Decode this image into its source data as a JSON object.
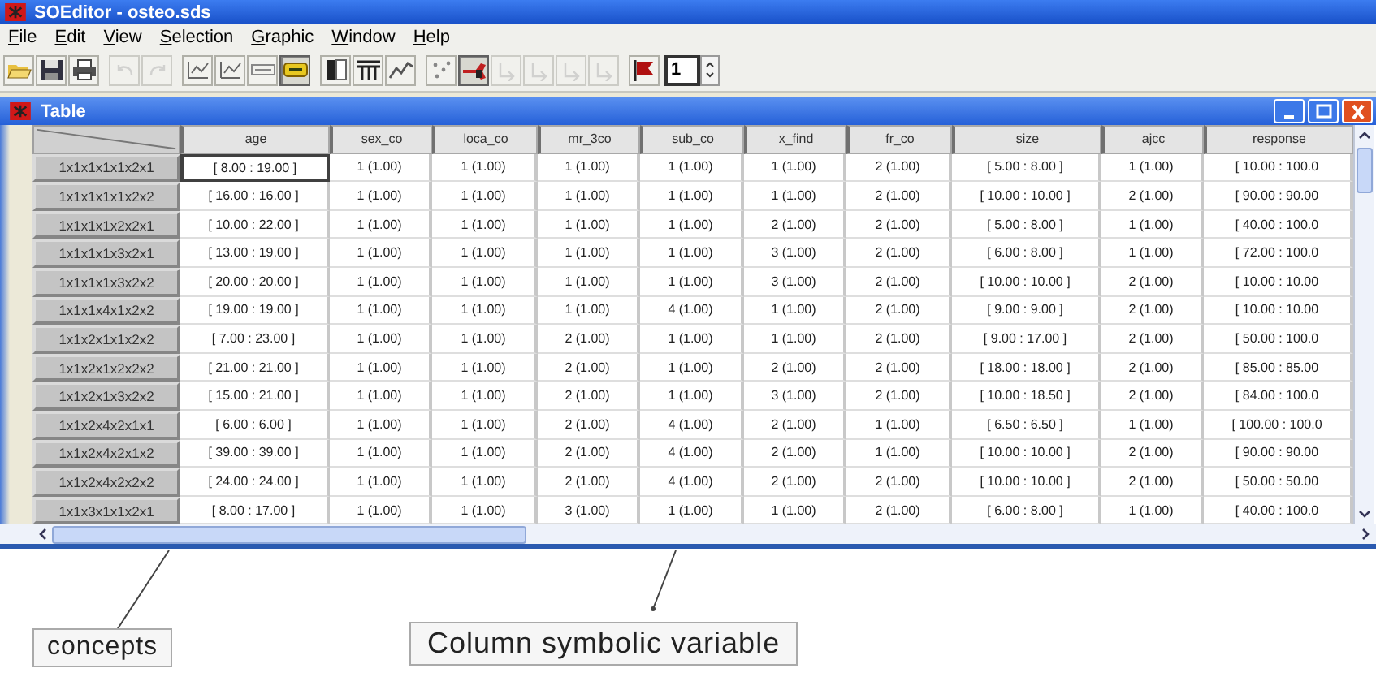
{
  "window": {
    "title": "SOEditor - osteo.sds"
  },
  "menu": [
    "File",
    "Edit",
    "View",
    "Selection",
    "Graphic",
    "Window",
    "Help"
  ],
  "toolbar": [
    [
      {
        "kind": "open",
        "pressed": false,
        "disabled": false
      },
      {
        "kind": "save",
        "pressed": false,
        "disabled": false
      },
      {
        "kind": "print",
        "pressed": false,
        "disabled": false
      }
    ],
    [
      {
        "kind": "undo",
        "pressed": false,
        "disabled": true
      },
      {
        "kind": "redo",
        "pressed": false,
        "disabled": true
      }
    ],
    [
      {
        "kind": "graph",
        "pressed": false,
        "disabled": false
      },
      {
        "kind": "graph",
        "pressed": false,
        "disabled": false
      },
      {
        "kind": "query",
        "pressed": false,
        "disabled": false
      },
      {
        "kind": "tag",
        "pressed": true,
        "disabled": false
      }
    ],
    [
      {
        "kind": "columns",
        "pressed": false,
        "disabled": false
      },
      {
        "kind": "table",
        "pressed": false,
        "disabled": false
      },
      {
        "kind": "zigzag",
        "pressed": false,
        "disabled": false
      }
    ],
    [
      {
        "kind": "scatter",
        "pressed": false,
        "disabled": false
      },
      {
        "kind": "tool",
        "pressed": true,
        "disabled": false
      },
      {
        "kind": "arrow",
        "pressed": false,
        "disabled": true
      },
      {
        "kind": "arrow",
        "pressed": false,
        "disabled": true
      },
      {
        "kind": "arrow",
        "pressed": false,
        "disabled": true
      },
      {
        "kind": "arrow",
        "pressed": false,
        "disabled": true
      }
    ],
    [
      {
        "kind": "flag",
        "pressed": false,
        "disabled": false
      }
    ]
  ],
  "spinner": {
    "value": "1"
  },
  "table_window": {
    "title": "Table",
    "columns": [
      "age",
      "sex_co",
      "loca_co",
      "mr_3co",
      "sub_co",
      "x_find",
      "fr_co",
      "size",
      "ajcc",
      "response"
    ],
    "rows": [
      {
        "concept": "1x1x1x1x1x2x1",
        "focused": true,
        "cells": [
          "[ 8.00 : 19.00 ]",
          "1 (1.00)",
          "1 (1.00)",
          "1 (1.00)",
          "1 (1.00)",
          "1 (1.00)",
          "2 (1.00)",
          "[ 5.00 : 8.00 ]",
          "1 (1.00)",
          "[ 10.00 : 100.0"
        ]
      },
      {
        "concept": "1x1x1x1x1x2x2",
        "focused": false,
        "cells": [
          "[ 16.00 : 16.00 ]",
          "1 (1.00)",
          "1 (1.00)",
          "1 (1.00)",
          "1 (1.00)",
          "1 (1.00)",
          "2 (1.00)",
          "[ 10.00 : 10.00 ]",
          "2 (1.00)",
          "[ 90.00 : 90.00"
        ]
      },
      {
        "concept": "1x1x1x1x2x2x1",
        "focused": false,
        "cells": [
          "[ 10.00 : 22.00 ]",
          "1 (1.00)",
          "1 (1.00)",
          "1 (1.00)",
          "1 (1.00)",
          "2 (1.00)",
          "2 (1.00)",
          "[ 5.00 : 8.00 ]",
          "1 (1.00)",
          "[ 40.00 : 100.0"
        ]
      },
      {
        "concept": "1x1x1x1x3x2x1",
        "focused": false,
        "cells": [
          "[ 13.00 : 19.00 ]",
          "1 (1.00)",
          "1 (1.00)",
          "1 (1.00)",
          "1 (1.00)",
          "3 (1.00)",
          "2 (1.00)",
          "[ 6.00 : 8.00 ]",
          "1 (1.00)",
          "[ 72.00 : 100.0"
        ]
      },
      {
        "concept": "1x1x1x1x3x2x2",
        "focused": false,
        "cells": [
          "[ 20.00 : 20.00 ]",
          "1 (1.00)",
          "1 (1.00)",
          "1 (1.00)",
          "1 (1.00)",
          "3 (1.00)",
          "2 (1.00)",
          "[ 10.00 : 10.00 ]",
          "2 (1.00)",
          "[ 10.00 : 10.00"
        ]
      },
      {
        "concept": "1x1x1x4x1x2x2",
        "focused": false,
        "cells": [
          "[ 19.00 : 19.00 ]",
          "1 (1.00)",
          "1 (1.00)",
          "1 (1.00)",
          "4 (1.00)",
          "1 (1.00)",
          "2 (1.00)",
          "[ 9.00 : 9.00 ]",
          "2 (1.00)",
          "[ 10.00 : 10.00"
        ]
      },
      {
        "concept": "1x1x2x1x1x2x2",
        "focused": false,
        "cells": [
          "[ 7.00 : 23.00 ]",
          "1 (1.00)",
          "1 (1.00)",
          "2 (1.00)",
          "1 (1.00)",
          "1 (1.00)",
          "2 (1.00)",
          "[ 9.00 : 17.00 ]",
          "2 (1.00)",
          "[ 50.00 : 100.0"
        ]
      },
      {
        "concept": "1x1x2x1x2x2x2",
        "focused": false,
        "cells": [
          "[ 21.00 : 21.00 ]",
          "1 (1.00)",
          "1 (1.00)",
          "2 (1.00)",
          "1 (1.00)",
          "2 (1.00)",
          "2 (1.00)",
          "[ 18.00 : 18.00 ]",
          "2 (1.00)",
          "[ 85.00 : 85.00"
        ]
      },
      {
        "concept": "1x1x2x1x3x2x2",
        "focused": false,
        "cells": [
          "[ 15.00 : 21.00 ]",
          "1 (1.00)",
          "1 (1.00)",
          "2 (1.00)",
          "1 (1.00)",
          "3 (1.00)",
          "2 (1.00)",
          "[ 10.00 : 18.50 ]",
          "2 (1.00)",
          "[ 84.00 : 100.0"
        ]
      },
      {
        "concept": "1x1x2x4x2x1x1",
        "focused": false,
        "cells": [
          "[ 6.00 : 6.00 ]",
          "1 (1.00)",
          "1 (1.00)",
          "2 (1.00)",
          "4 (1.00)",
          "2 (1.00)",
          "1 (1.00)",
          "[ 6.50 : 6.50 ]",
          "1 (1.00)",
          "[ 100.00 : 100.0"
        ]
      },
      {
        "concept": "1x1x2x4x2x1x2",
        "focused": false,
        "cells": [
          "[ 39.00 : 39.00 ]",
          "1 (1.00)",
          "1 (1.00)",
          "2 (1.00)",
          "4 (1.00)",
          "2 (1.00)",
          "1 (1.00)",
          "[ 10.00 : 10.00 ]",
          "2 (1.00)",
          "[ 90.00 : 90.00"
        ]
      },
      {
        "concept": "1x1x2x4x2x2x2",
        "focused": false,
        "cells": [
          "[ 24.00 : 24.00 ]",
          "1 (1.00)",
          "1 (1.00)",
          "2 (1.00)",
          "4 (1.00)",
          "2 (1.00)",
          "2 (1.00)",
          "[ 10.00 : 10.00 ]",
          "2 (1.00)",
          "[ 50.00 : 50.00"
        ]
      },
      {
        "concept": "1x1x3x1x1x2x1",
        "focused": false,
        "cells": [
          "[ 8.00 : 17.00 ]",
          "1 (1.00)",
          "1 (1.00)",
          "3 (1.00)",
          "1 (1.00)",
          "1 (1.00)",
          "2 (1.00)",
          "[ 6.00 : 8.00 ]",
          "1 (1.00)",
          "[ 40.00 : 100.0"
        ]
      }
    ]
  },
  "callouts": [
    "concepts",
    "Column symbolic variable"
  ]
}
